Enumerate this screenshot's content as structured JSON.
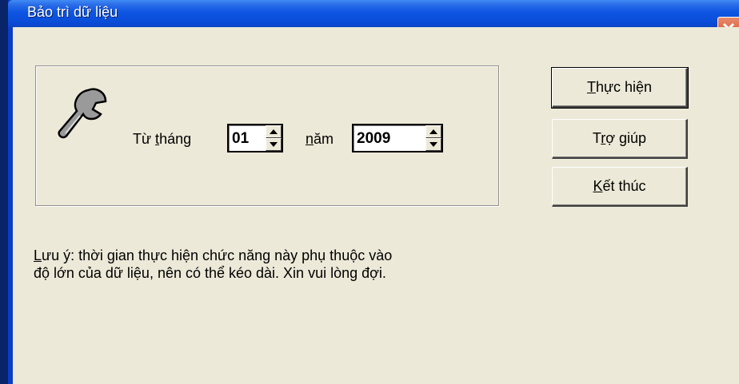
{
  "window": {
    "title": "Bảo trì dữ liệu"
  },
  "form": {
    "from_month_label_pre": "Từ ",
    "from_month_label_u": "t",
    "from_month_label_post": "háng",
    "month_value": "01",
    "year_label_u": "n",
    "year_label_post": "ăm",
    "year_value": "2009"
  },
  "buttons": {
    "execute_u": "T",
    "execute_rest": "hực hiện",
    "help_pre": "T",
    "help_u": "r",
    "help_post": "ợ giúp",
    "finish_u": "K",
    "finish_rest": "ết thúc"
  },
  "note": {
    "line1_u": "L",
    "line1_rest": "ưu ý: thời gian thực hiện chức năng này phụ thuộc vào",
    "line2": "độ lớn của dữ liệu, nên có thể kéo dài. Xin vui lòng đợi."
  },
  "icons": [
    "wrench-icon",
    "close-icon",
    "arrow-up-icon",
    "arrow-down-icon"
  ]
}
